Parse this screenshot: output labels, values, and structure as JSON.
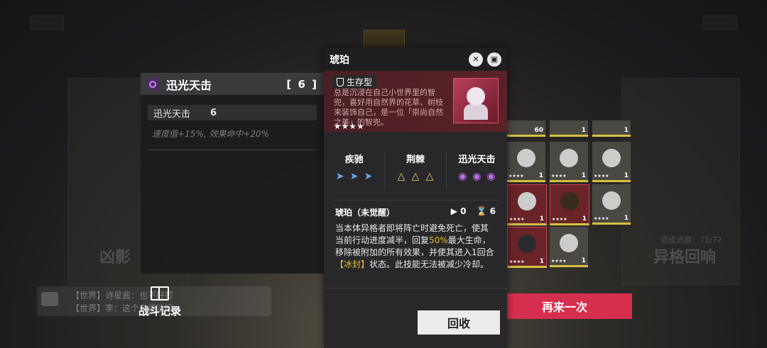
{
  "skill_panel": {
    "title": "迅光天击",
    "count": "[ 6 ]",
    "row_name": "迅光天击",
    "row_level": "6",
    "bonus": "速度值+15%, 效果命中+20%"
  },
  "character": {
    "name": "琥珀",
    "type": "生存型",
    "description": "总是沉浸在自己小世界里的智兜，喜好用自然界的花草、树枝来装饰自己，是一位「崇尚自然之美」的智兜。",
    "stars": "★★★★",
    "traits": [
      {
        "name": "疾驰",
        "icon": "dash-icon"
      },
      {
        "name": "荆棘",
        "icon": "thorn-icon"
      },
      {
        "name": "迅光天击",
        "icon": "swirl-icon"
      }
    ],
    "skill_name": "琥珀（未觉醒）",
    "skill_stat1": "▶ 0",
    "skill_stat2": "⌛ 6",
    "effect_a": "当本体异格者即将阵亡时避免死亡，使其当前行动进度减半，回复",
    "effect_hl1": "50%",
    "effect_b": "最大生命，移除被附加的所有效果，并使其进入1回合",
    "effect_hl2": "【冰封】",
    "effect_c": "状态。此技能无法被减少冷却。",
    "recall_label": "回收"
  },
  "background": {
    "left_title": "凶影",
    "right_title": "异格回响",
    "right_sub": "完成进度：71/72",
    "battle_record": "战斗记录",
    "again_label": "再来一次",
    "chat1": "【世界】诗星酱：也不好打",
    "chat2": "【世界】李：这个有说法吗"
  },
  "grid_levels": [
    "60",
    "1",
    "1",
    "1",
    "1",
    "1",
    "1",
    "1",
    "1",
    "1",
    "1"
  ],
  "colors": {
    "accent_red": "#d62f4d",
    "highlight": "#e8b830",
    "purple": "#c070f0"
  }
}
